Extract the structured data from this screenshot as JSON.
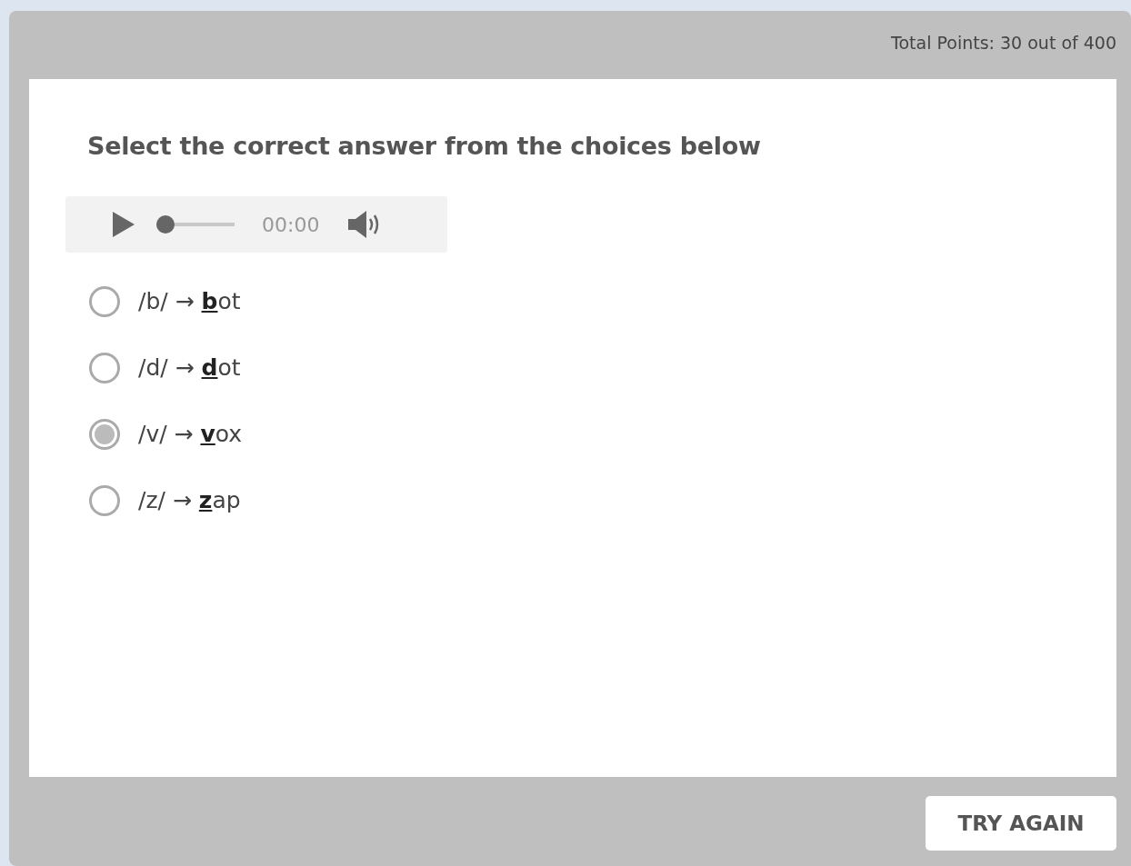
{
  "header": {
    "total_points": "Total Points: 30 out of 400"
  },
  "question": "Select the correct answer from the choices below",
  "audio_player": {
    "level": 0,
    "time": "00:00"
  },
  "choices": [
    {
      "label": "/b/ → **b**ot",
      "selected": false
    },
    {
      "label": "/d/ → **d**ot",
      "selected": false
    },
    {
      "label": "/v/ → **v**ox",
      "selected": true
    },
    {
      "label": "/z/ → **z**ap",
      "selected": false
    }
  ],
  "buttons": [
    "TRY AGAIN"
  ]
}
